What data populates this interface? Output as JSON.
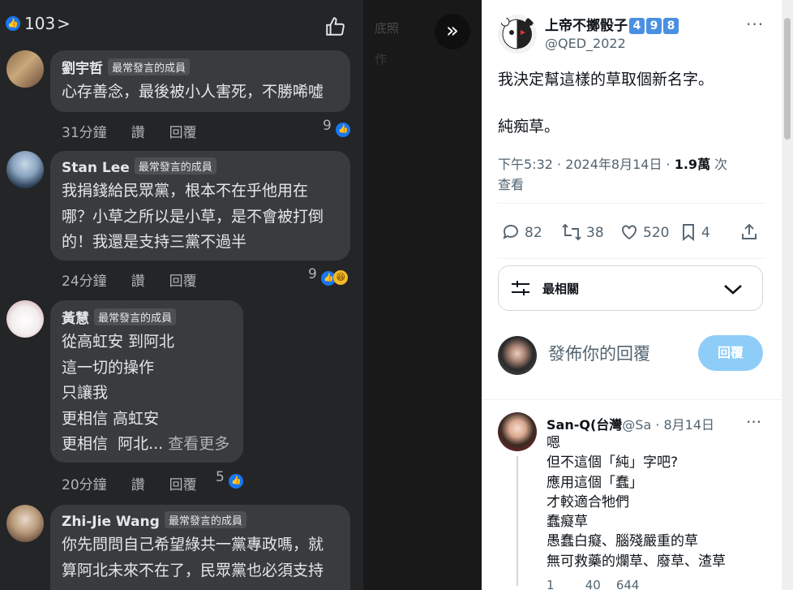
{
  "fb": {
    "like_count": "103",
    "chevron": ">",
    "comments": [
      {
        "author": "劉宇哲",
        "badge": "最常發言的成員",
        "text": "心存善念，最後被小人害死，不勝唏噓",
        "time": "31分鐘",
        "like_action": "讚",
        "reply_action": "回覆",
        "reactions": "9"
      },
      {
        "author": "Stan Lee",
        "badge": "最常發言的成員",
        "text": "我捐錢給民眾黨，根本不在乎他用在\n哪？小草之所以是小草，是不會被打倒\n的！我還是支持三黨不過半",
        "time": "24分鐘",
        "like_action": "讚",
        "reply_action": "回覆",
        "reactions": "9"
      },
      {
        "author": "黃慧",
        "badge": "最常發言的成員",
        "text": "從高虹安 到阿北\n這一切的操作\n只讓我\n更相信 高虹安\n更相信  阿北...",
        "more": " 查看更多",
        "time": "20分鐘",
        "like_action": "讚",
        "reply_action": "回覆",
        "reactions": "5"
      },
      {
        "author": "Zhi-Jie Wang",
        "badge": "最常發言的成員",
        "text": "你先問問自己希望綠共一黨專政嗎，就\n算阿北未來不在了，民眾黨也必須支持"
      }
    ]
  },
  "mid": {
    "text1": "底照",
    "text2": "作"
  },
  "tweet": {
    "name": "上帝不擲骰子",
    "keycaps": [
      "4",
      "9",
      "8"
    ],
    "handle": "@QED_2022",
    "more": "···",
    "body": "我決定幫這樣的草取個新名字。\n\n純痴草。",
    "meta_time": "下午5:32 · 2024年8月14日 · ",
    "meta_views": "1.9萬",
    "meta_views_label": " 次\n查看",
    "stats": {
      "replies": "82",
      "retweets": "38",
      "likes": "520",
      "bookmarks": "4"
    },
    "sort_label": "最相關",
    "reply_placeholder": "發佈你的回覆",
    "reply_button": "回覆"
  },
  "reply": {
    "name": "San-Q(台灣",
    "handle_date": "@Sa · 8月14日",
    "more": "···",
    "body": "嗯\n但不這個「純」字吧?\n應用這個「蠢」\n才較適合牠們\n蠢癡草\n愚蠢白癡、腦殘嚴重的草\n無可救藥的爛草、廢草、渣草",
    "stats": "1        40    644"
  },
  "colors": {
    "fb_bg": "#242526",
    "bubble": "#3a3b3c",
    "fb_blue": "#1877f2",
    "twitter_blue": "#1d9bf0",
    "reply_button": "#8ecdf8"
  }
}
